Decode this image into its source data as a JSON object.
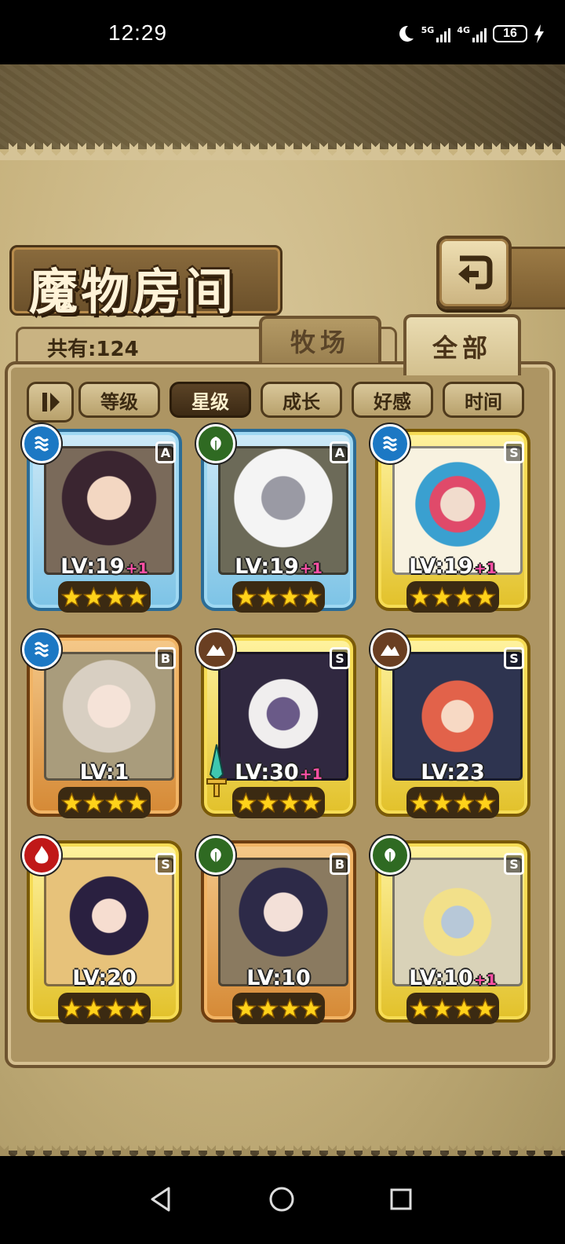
{
  "status_bar": {
    "time": "12:29",
    "net1": "5G",
    "net2": "4G",
    "battery": "16",
    "icons": [
      "moon-icon",
      "signal-5g-icon",
      "signal-4g-icon",
      "battery-icon",
      "charging-icon"
    ]
  },
  "screen": {
    "title": "魔物房间",
    "back_icon": "back-arrow-icon",
    "count_label": "共有:124",
    "tabs": [
      {
        "label": "牧场",
        "active": false
      },
      {
        "label": "全部",
        "active": true
      }
    ],
    "sort_toggle_icon": "pause-sort-icon",
    "sort_buttons": [
      {
        "label": "等级",
        "active": false
      },
      {
        "label": "星级",
        "active": true
      },
      {
        "label": "成长",
        "active": false
      },
      {
        "label": "好感",
        "active": false
      },
      {
        "label": "时间",
        "active": false
      }
    ]
  },
  "monsters": [
    {
      "lv": "LV:19",
      "plus": "+1",
      "rank": "A",
      "element": "water",
      "frame": "blue",
      "stars": 4
    },
    {
      "lv": "LV:19",
      "plus": "+1",
      "rank": "A",
      "element": "grass",
      "frame": "blue",
      "stars": 4
    },
    {
      "lv": "LV:19",
      "plus": "+1",
      "rank": "S",
      "element": "water",
      "frame": "gold",
      "stars": 4
    },
    {
      "lv": "LV:1",
      "plus": "",
      "rank": "B",
      "element": "water",
      "frame": "orange",
      "stars": 4
    },
    {
      "lv": "LV:30",
      "plus": "+1",
      "rank": "S",
      "element": "earth",
      "frame": "gold",
      "stars": 4
    },
    {
      "lv": "LV:23",
      "plus": "",
      "rank": "S",
      "element": "earth",
      "frame": "gold",
      "stars": 4
    },
    {
      "lv": "LV:20",
      "plus": "",
      "rank": "S",
      "element": "fire",
      "frame": "gold",
      "stars": 4
    },
    {
      "lv": "LV:10",
      "plus": "",
      "rank": "B",
      "element": "grass",
      "frame": "orange",
      "stars": 4
    },
    {
      "lv": "LV:10",
      "plus": "+1",
      "rank": "S",
      "element": "grass",
      "frame": "gold",
      "stars": 4
    }
  ],
  "nav": {
    "icons": [
      "nav-back-icon",
      "nav-home-icon",
      "nav-recents-icon"
    ]
  },
  "colors": {
    "star": "#ffd21a",
    "plus": "#ff4fa4",
    "water": "#1c78c4",
    "grass": "#2f6a22",
    "earth": "#6a3f22",
    "fire": "#c01818"
  }
}
